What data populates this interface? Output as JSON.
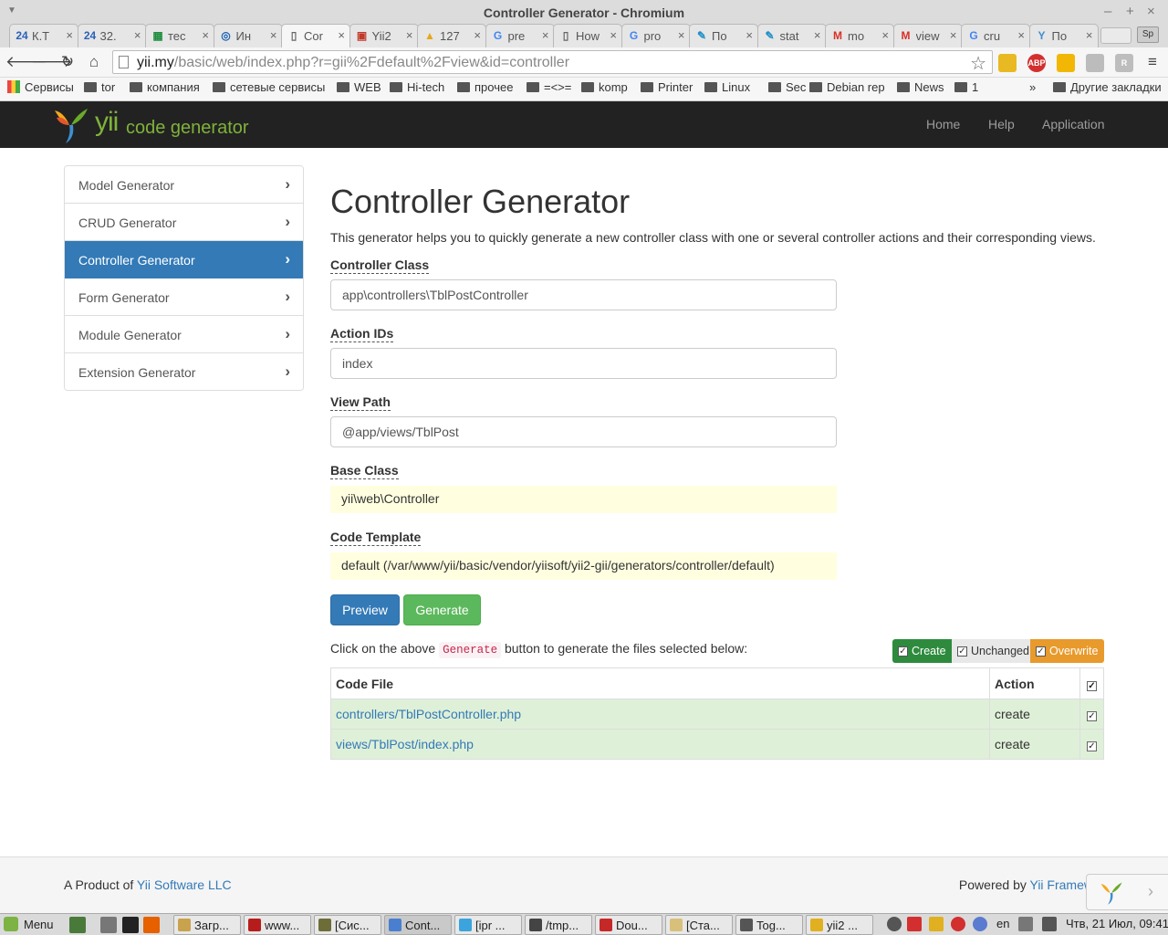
{
  "window": {
    "title": "Controller Generator - Chromium"
  },
  "tabs": [
    {
      "icon": "24",
      "label": "К.Т",
      "color": "#2a62b8"
    },
    {
      "icon": "24",
      "label": "32.",
      "color": "#2a62b8"
    },
    {
      "icon": "▦",
      "label": "тес",
      "color": "#1e8e3e"
    },
    {
      "icon": "◎",
      "label": "Ин",
      "color": "#1a5fb4"
    },
    {
      "icon": "▯",
      "label": "Cor",
      "color": "#666666"
    },
    {
      "icon": "▣",
      "label": "Yii2",
      "color": "#c0392b"
    },
    {
      "icon": "▲",
      "label": "127",
      "color": "#e6a817"
    },
    {
      "icon": "G",
      "label": "pre",
      "color": "#4285f4"
    },
    {
      "icon": "▯",
      "label": "How",
      "color": "#666666"
    },
    {
      "icon": "G",
      "label": "pro",
      "color": "#4285f4"
    },
    {
      "icon": "✎",
      "label": "По",
      "color": "#1e90c8"
    },
    {
      "icon": "✎",
      "label": "stat",
      "color": "#1e90c8"
    },
    {
      "icon": "M",
      "label": "mo",
      "color": "#d93025"
    },
    {
      "icon": "M",
      "label": "view",
      "color": "#d93025"
    },
    {
      "icon": "G",
      "label": "cru",
      "color": "#4285f4"
    },
    {
      "icon": "Y",
      "label": "По",
      "color": "#3d8fd1"
    }
  ],
  "profile_badge": "Sp",
  "address_bar": {
    "host": "yii.my",
    "path": "/basic/web/index.php?r=gii%2Fdefault%2Fview&id=controller"
  },
  "extensions": [
    {
      "label": "",
      "color": "#e8b923"
    },
    {
      "label": "ABP",
      "color": "#d32f2f"
    },
    {
      "label": "",
      "color": "#f2b705"
    },
    {
      "label": "",
      "color": "#bcbcbc"
    },
    {
      "label": "R",
      "color": "#bdbdbd"
    }
  ],
  "bookmarks": {
    "apps_label": "Сервисы",
    "folders": [
      "tor",
      "компания",
      "сетевые сервисы",
      "WEB",
      "Hi-tech",
      "прочее",
      "=<>=",
      "komp",
      "Printer",
      "Linux",
      "Sec",
      "Debian rep",
      "News",
      "1"
    ],
    "overflow": "»",
    "other": "Другие закладки"
  },
  "navbar": {
    "brand_yii": "yii",
    "brand_text": "code generator",
    "links": [
      "Home",
      "Help",
      "Application"
    ]
  },
  "sidebar": {
    "items": [
      {
        "label": "Model Generator",
        "active": false
      },
      {
        "label": "CRUD Generator",
        "active": false
      },
      {
        "label": "Controller Generator",
        "active": true
      },
      {
        "label": "Form Generator",
        "active": false
      },
      {
        "label": "Module Generator",
        "active": false
      },
      {
        "label": "Extension Generator",
        "active": false
      }
    ],
    "chevron": "›"
  },
  "main": {
    "title": "Controller Generator",
    "description": "This generator helps you to quickly generate a new controller class with one or several controller actions and their corresponding views.",
    "fields": {
      "controller_class": {
        "label": "Controller Class",
        "value": "app\\controllers\\TblPostController"
      },
      "action_ids": {
        "label": "Action IDs",
        "value": "index"
      },
      "view_path": {
        "label": "View Path",
        "value": "@app/views/TblPost"
      },
      "base_class": {
        "label": "Base Class",
        "value": "yii\\web\\Controller"
      },
      "code_template": {
        "label": "Code Template",
        "value": "default (/var/www/yii/basic/vendor/yiisoft/yii2-gii/generators/controller/default)"
      }
    },
    "buttons": {
      "preview": "Preview",
      "generate": "Generate"
    },
    "generate_note": {
      "before": "Click on the above ",
      "code": "Generate",
      "after": " button to generate the files selected below:"
    },
    "legend": {
      "create": "Create",
      "unchanged": "Unchanged",
      "overwrite": "Overwrite"
    },
    "table": {
      "headers": {
        "file": "Code File",
        "action": "Action"
      },
      "rows": [
        {
          "file": "controllers/TblPostController.php",
          "action": "create"
        },
        {
          "file": "views/TblPost/index.php",
          "action": "create"
        }
      ]
    }
  },
  "footer": {
    "left_prefix": "A Product of ",
    "left_link": "Yii Software LLC",
    "right_prefix": "Powered by ",
    "right_link": "Yii Framew"
  },
  "taskbar": {
    "menu": "Menu",
    "tasks": [
      {
        "label": "Загр...",
        "color": "#c9a24d"
      },
      {
        "label": "www...",
        "color": "#b71c1c"
      },
      {
        "label": "[Сис...",
        "color": "#6d6d3a"
      },
      {
        "label": "Cont...",
        "color": "#4a7fd0",
        "active": true
      },
      {
        "label": "[ipr ...",
        "color": "#3ba4dd"
      },
      {
        "label": "/tmp...",
        "color": "#444444"
      },
      {
        "label": "Dou...",
        "color": "#c62828"
      },
      {
        "label": "[Ста...",
        "color": "#d8c07a"
      },
      {
        "label": "Tog...",
        "color": "#555555"
      },
      {
        "label": "yii2 ...",
        "color": "#e0b020"
      }
    ],
    "lang": "en",
    "clock": "Чтв, 21 Июл, 09:41"
  }
}
